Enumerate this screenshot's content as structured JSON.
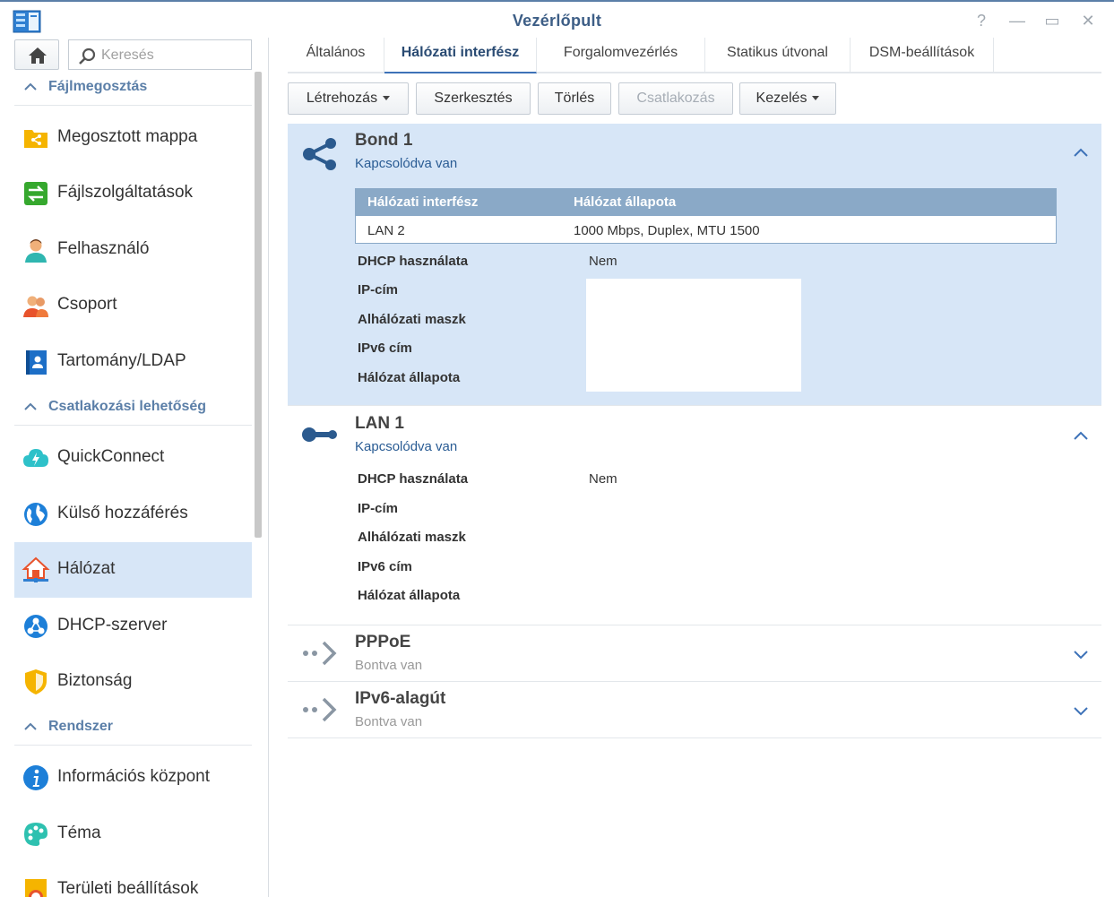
{
  "window": {
    "title": "Vezérlőpult",
    "help": "?",
    "minimize": "—",
    "maximize": "▭",
    "close": "✕"
  },
  "sidebar": {
    "search_placeholder": "Keresés",
    "sections": [
      {
        "title": "Fájlmegosztás",
        "items": [
          {
            "label": "Megosztott mappa",
            "icon": "shared-folder-icon"
          },
          {
            "label": "Fájlszolgáltatások",
            "icon": "file-services-icon"
          },
          {
            "label": "Felhasználó",
            "icon": "user-icon"
          },
          {
            "label": "Csoport",
            "icon": "group-icon"
          },
          {
            "label": "Tartomány/LDAP",
            "icon": "domain-ldap-icon"
          }
        ]
      },
      {
        "title": "Csatlakozási lehetőség",
        "items": [
          {
            "label": "QuickConnect",
            "icon": "quickconnect-icon"
          },
          {
            "label": "Külső hozzáférés",
            "icon": "external-access-icon"
          },
          {
            "label": "Hálózat",
            "icon": "network-icon",
            "active": true
          },
          {
            "label": "DHCP-szerver",
            "icon": "dhcp-server-icon"
          },
          {
            "label": "Biztonság",
            "icon": "security-icon"
          }
        ]
      },
      {
        "title": "Rendszer",
        "items": [
          {
            "label": "Információs központ",
            "icon": "info-center-icon"
          },
          {
            "label": "Téma",
            "icon": "theme-icon"
          },
          {
            "label": "Területi beállítások",
            "icon": "regional-settings-icon"
          }
        ]
      }
    ]
  },
  "tabs": [
    {
      "label": "Általános"
    },
    {
      "label": "Hálózati interfész",
      "active": true
    },
    {
      "label": "Forgalomvezérlés"
    },
    {
      "label": "Statikus útvonal"
    },
    {
      "label": "DSM-beállítások"
    }
  ],
  "toolbar": {
    "create": "Létrehozás",
    "edit": "Szerkesztés",
    "delete": "Törlés",
    "connect": "Csatlakozás",
    "manage": "Kezelés"
  },
  "interfaces": {
    "bond1": {
      "name": "Bond 1",
      "status": "Kapcsolódva van",
      "table_headers": [
        "Hálózati interfész",
        "Hálózat állapota"
      ],
      "table_row": [
        "LAN 2",
        "1000 Mbps, Duplex, MTU 1500"
      ],
      "dhcp_label": "DHCP használata",
      "dhcp_value": "Nem",
      "ip_label": "IP-cím",
      "mask_label": "Alhálózati maszk",
      "ipv6_label": "IPv6 cím",
      "state_label": "Hálózat állapota"
    },
    "lan1": {
      "name": "LAN 1",
      "status": "Kapcsolódva van",
      "dhcp_label": "DHCP használata",
      "dhcp_value": "Nem",
      "ip_label": "IP-cím",
      "mask_label": "Alhálózati maszk",
      "ipv6_label": "IPv6 cím",
      "state_label": "Hálózat állapota"
    },
    "pppoe": {
      "name": "PPPoE",
      "status": "Bontva van"
    },
    "ipv6tunnel": {
      "name": "IPv6-alagút",
      "status": "Bontva van"
    }
  },
  "colors": {
    "accent": "#5b7fa8",
    "active_bg": "#d7e6f7",
    "table_header": "#8aa9c7",
    "status_connected": "#2a5c94",
    "status_disconnected": "#999999"
  }
}
